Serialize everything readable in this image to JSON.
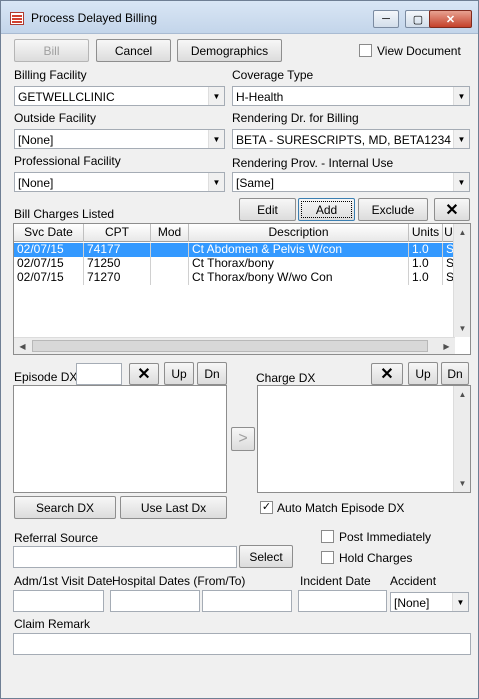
{
  "window": {
    "title": "Process Delayed Billing",
    "close_icon": "close-icon"
  },
  "toolbar": {
    "bill": "Bill",
    "cancel": "Cancel",
    "demographics": "Demographics",
    "view_document": "View Document"
  },
  "billing_facility": {
    "label": "Billing Facility",
    "value": "GETWELLCLINIC"
  },
  "coverage_type": {
    "label": "Coverage Type",
    "value": "H-Health"
  },
  "outside_facility": {
    "label": "Outside Facility",
    "value": "[None]"
  },
  "rendering_dr": {
    "label": "Rendering Dr. for Billing",
    "value": "BETA - SURESCRIPTS, MD, BETA1234"
  },
  "professional_facility": {
    "label": "Professional Facility",
    "value": "[None]"
  },
  "rendering_prov": {
    "label": "Rendering Prov. - Internal Use",
    "value": "[Same]"
  },
  "charges": {
    "label": "Bill Charges Listed",
    "edit": "Edit",
    "add": "Add",
    "exclude": "Exclude",
    "columns": [
      "Svc Date",
      "CPT",
      "Mod",
      "Description",
      "Units",
      "U"
    ],
    "rows": [
      {
        "svc_date": "02/07/15",
        "cpt": "74177",
        "mod": "",
        "description": "Ct Abdomen & Pelvis W/con",
        "units": "1.0",
        "u": "S",
        "selected": true
      },
      {
        "svc_date": "02/07/15",
        "cpt": "71250",
        "mod": "",
        "description": "Ct Thorax/bony",
        "units": "1.0",
        "u": "S",
        "selected": false
      },
      {
        "svc_date": "02/07/15",
        "cpt": "71270",
        "mod": "",
        "description": "Ct Thorax/bony W/wo Con",
        "units": "1.0",
        "u": "S",
        "selected": false
      }
    ]
  },
  "episode_dx": {
    "label": "Episode DX",
    "up": "Up",
    "dn": "Dn"
  },
  "charge_dx": {
    "label": "Charge DX",
    "up": "Up",
    "dn": "Dn"
  },
  "move_arrow": ">",
  "search_dx": "Search DX",
  "use_last_dx": "Use Last Dx",
  "auto_match": {
    "label": "Auto Match Episode DX",
    "checked": true
  },
  "referral_source": {
    "label": "Referral Source",
    "select": "Select"
  },
  "post_immediately": "Post Immediately",
  "hold_charges": "Hold Charges",
  "adm_visit_date": "Adm/1st Visit Date",
  "hospital_dates": "Hospital Dates (From/To)",
  "incident_date": "Incident Date",
  "accident": {
    "label": "Accident",
    "value": "[None]"
  },
  "claim_remark": "Claim Remark"
}
